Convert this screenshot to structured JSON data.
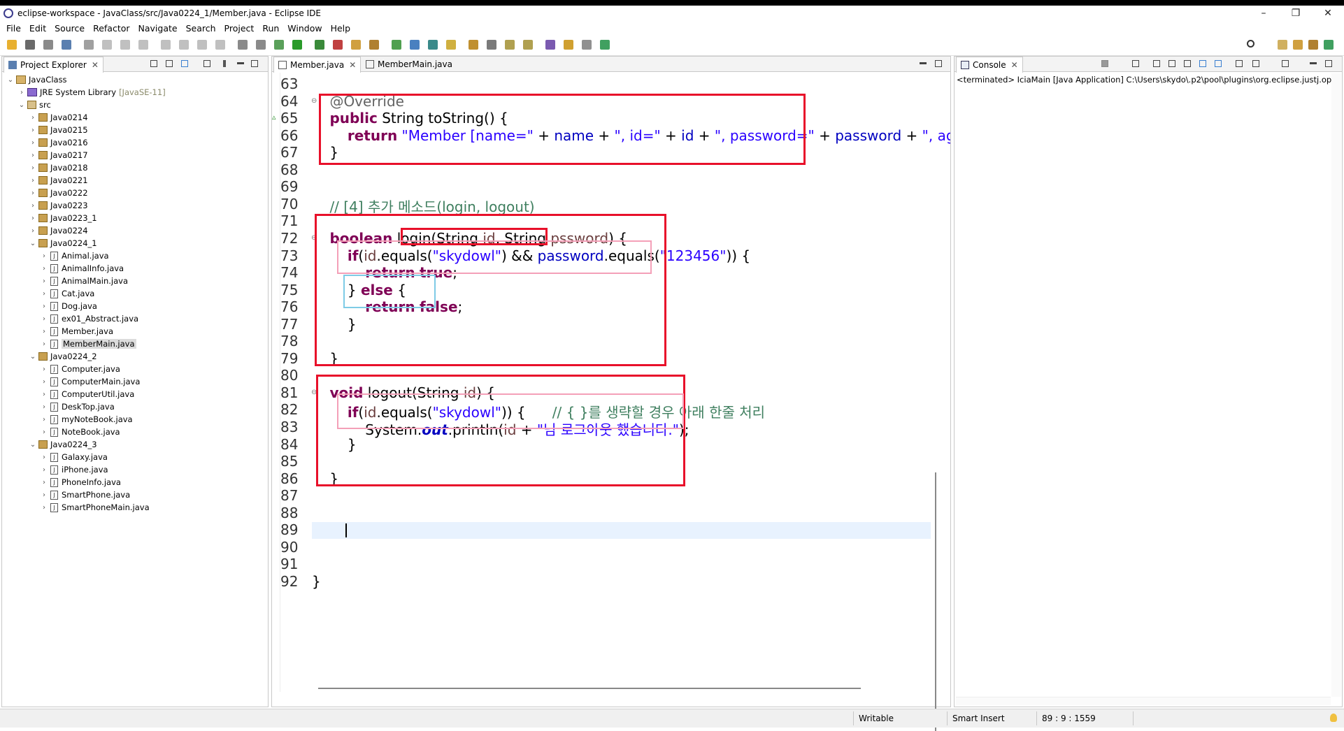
{
  "window": {
    "title": "eclipse-workspace - JavaClass/src/Java0224_1/Member.java - Eclipse IDE",
    "minimize": "–",
    "maximize": "❐",
    "close": "✕"
  },
  "menu": [
    "File",
    "Edit",
    "Source",
    "Refactor",
    "Navigate",
    "Search",
    "Project",
    "Run",
    "Window",
    "Help"
  ],
  "project_explorer": {
    "tab_label": "Project Explorer",
    "items": [
      {
        "label": "JavaClass",
        "type": "project",
        "level": 0,
        "expanded": true
      },
      {
        "label": "JRE System Library",
        "suffix": "[JavaSE-11]",
        "type": "library",
        "level": 1,
        "expanded": false
      },
      {
        "label": "src",
        "type": "folder",
        "level": 1,
        "expanded": true
      },
      {
        "label": "Java0214",
        "type": "package",
        "level": 2,
        "expanded": false
      },
      {
        "label": "Java0215",
        "type": "package",
        "level": 2,
        "expanded": false
      },
      {
        "label": "Java0216",
        "type": "package",
        "level": 2,
        "expanded": false
      },
      {
        "label": "Java0217",
        "type": "package",
        "level": 2,
        "expanded": false
      },
      {
        "label": "Java0218",
        "type": "package",
        "level": 2,
        "expanded": false
      },
      {
        "label": "Java0221",
        "type": "package",
        "level": 2,
        "expanded": false
      },
      {
        "label": "Java0222",
        "type": "package",
        "level": 2,
        "expanded": false
      },
      {
        "label": "Java0223",
        "type": "package",
        "level": 2,
        "expanded": false
      },
      {
        "label": "Java0223_1",
        "type": "package",
        "level": 2,
        "expanded": false
      },
      {
        "label": "Java0224",
        "type": "package",
        "level": 2,
        "expanded": false
      },
      {
        "label": "Java0224_1",
        "type": "package",
        "level": 2,
        "expanded": true
      },
      {
        "label": "Animal.java",
        "type": "file",
        "level": 3,
        "expanded": false
      },
      {
        "label": "AnimalInfo.java",
        "type": "file",
        "level": 3,
        "expanded": false
      },
      {
        "label": "AnimalMain.java",
        "type": "file",
        "level": 3,
        "expanded": false
      },
      {
        "label": "Cat.java",
        "type": "file",
        "level": 3,
        "expanded": false
      },
      {
        "label": "Dog.java",
        "type": "file",
        "level": 3,
        "expanded": false
      },
      {
        "label": "ex01_Abstract.java",
        "type": "file",
        "level": 3,
        "expanded": false
      },
      {
        "label": "Member.java",
        "type": "file",
        "level": 3,
        "expanded": false
      },
      {
        "label": "MemberMain.java",
        "type": "file",
        "level": 3,
        "expanded": false,
        "selected": true
      },
      {
        "label": "Java0224_2",
        "type": "package",
        "level": 2,
        "expanded": true
      },
      {
        "label": "Computer.java",
        "type": "file",
        "level": 3,
        "expanded": false
      },
      {
        "label": "ComputerMain.java",
        "type": "file",
        "level": 3,
        "expanded": false
      },
      {
        "label": "ComputerUtil.java",
        "type": "file",
        "level": 3,
        "expanded": false
      },
      {
        "label": "DeskTop.java",
        "type": "file",
        "level": 3,
        "expanded": false
      },
      {
        "label": "myNoteBook.java",
        "type": "file",
        "level": 3,
        "expanded": false
      },
      {
        "label": "NoteBook.java",
        "type": "file",
        "level": 3,
        "expanded": false
      },
      {
        "label": "Java0224_3",
        "type": "package",
        "level": 2,
        "expanded": true
      },
      {
        "label": "Galaxy.java",
        "type": "file",
        "level": 3,
        "expanded": false
      },
      {
        "label": "iPhone.java",
        "type": "file",
        "level": 3,
        "expanded": false
      },
      {
        "label": "PhoneInfo.java",
        "type": "file",
        "level": 3,
        "expanded": false
      },
      {
        "label": "SmartPhone.java",
        "type": "file",
        "level": 3,
        "expanded": false
      },
      {
        "label": "SmartPhoneMain.java",
        "type": "file",
        "level": 3,
        "expanded": false
      }
    ]
  },
  "editor": {
    "tabs": [
      {
        "label": "Member.java",
        "active": true
      },
      {
        "label": "MemberMain.java",
        "active": false
      }
    ],
    "lines": [
      {
        "n": "63",
        "tokens": []
      },
      {
        "n": "64",
        "fold": "⊖",
        "tokens": [
          {
            "t": "    "
          },
          {
            "t": "@Override",
            "c": "ann"
          }
        ]
      },
      {
        "n": "65",
        "marker": "▵",
        "tokens": [
          {
            "t": "    "
          },
          {
            "t": "public",
            "c": "kw"
          },
          {
            "t": " String toString() {"
          }
        ]
      },
      {
        "n": "66",
        "tokens": [
          {
            "t": "        "
          },
          {
            "t": "return",
            "c": "kw"
          },
          {
            "t": " "
          },
          {
            "t": "\"Member [name=\"",
            "c": "str"
          },
          {
            "t": " + "
          },
          {
            "t": "name",
            "c": "fld"
          },
          {
            "t": " + "
          },
          {
            "t": "\", id=\"",
            "c": "str"
          },
          {
            "t": " + "
          },
          {
            "t": "id",
            "c": "fld"
          },
          {
            "t": " + "
          },
          {
            "t": "\", password=\"",
            "c": "str"
          },
          {
            "t": " + "
          },
          {
            "t": "password",
            "c": "fld"
          },
          {
            "t": " + "
          },
          {
            "t": "\", age=\"",
            "c": "str"
          },
          {
            "t": " +"
          }
        ]
      },
      {
        "n": "67",
        "tokens": [
          {
            "t": "    }"
          }
        ]
      },
      {
        "n": "68",
        "tokens": []
      },
      {
        "n": "69",
        "tokens": []
      },
      {
        "n": "70",
        "tokens": [
          {
            "t": "    "
          },
          {
            "t": "// [4] 추가 메소드(login, logout)",
            "c": "cm"
          }
        ]
      },
      {
        "n": "71",
        "tokens": []
      },
      {
        "n": "72",
        "fold": "⊖",
        "tokens": [
          {
            "t": "    "
          },
          {
            "t": "boolean",
            "c": "kw"
          },
          {
            "t": " login("
          },
          {
            "t": "String "
          },
          {
            "t": "id",
            "c": "par"
          },
          {
            "t": ", String "
          },
          {
            "t": "pssword",
            "c": "par"
          },
          {
            "t": ") {"
          }
        ]
      },
      {
        "n": "73",
        "tokens": [
          {
            "t": "        "
          },
          {
            "t": "if",
            "c": "kw"
          },
          {
            "t": "("
          },
          {
            "t": "id",
            "c": "par"
          },
          {
            "t": ".equals("
          },
          {
            "t": "\"skydowl\"",
            "c": "str"
          },
          {
            "t": ") && "
          },
          {
            "t": "password",
            "c": "fld"
          },
          {
            "t": ".equals("
          },
          {
            "t": "\"123456\"",
            "c": "str"
          },
          {
            "t": ")) {"
          }
        ]
      },
      {
        "n": "74",
        "tokens": [
          {
            "t": "            "
          },
          {
            "t": "return",
            "c": "kw"
          },
          {
            "t": " "
          },
          {
            "t": "true",
            "c": "kw"
          },
          {
            "t": ";"
          }
        ]
      },
      {
        "n": "75",
        "tokens": [
          {
            "t": "        } "
          },
          {
            "t": "else",
            "c": "kw"
          },
          {
            "t": " {"
          }
        ]
      },
      {
        "n": "76",
        "tokens": [
          {
            "t": "            "
          },
          {
            "t": "return",
            "c": "kw"
          },
          {
            "t": " "
          },
          {
            "t": "false",
            "c": "kw"
          },
          {
            "t": ";"
          }
        ]
      },
      {
        "n": "77",
        "tokens": [
          {
            "t": "        }"
          }
        ]
      },
      {
        "n": "78",
        "tokens": []
      },
      {
        "n": "79",
        "tokens": [
          {
            "t": "    }"
          }
        ]
      },
      {
        "n": "80",
        "tokens": []
      },
      {
        "n": "81",
        "fold": "⊖",
        "tokens": [
          {
            "t": "    "
          },
          {
            "t": "void",
            "c": "kw"
          },
          {
            "t": " logout(String "
          },
          {
            "t": "id",
            "c": "par"
          },
          {
            "t": ") {"
          }
        ]
      },
      {
        "n": "82",
        "tokens": [
          {
            "t": "        "
          },
          {
            "t": "if",
            "c": "kw"
          },
          {
            "t": "("
          },
          {
            "t": "id",
            "c": "par"
          },
          {
            "t": ".equals("
          },
          {
            "t": "\"skydowl\"",
            "c": "str"
          },
          {
            "t": ")) {      "
          },
          {
            "t": "// { }를 생략할 경우 아래 한줄 처리",
            "c": "cm"
          }
        ]
      },
      {
        "n": "83",
        "tokens": [
          {
            "t": "            System."
          },
          {
            "t": "out",
            "c": "sfld"
          },
          {
            "t": ".println("
          },
          {
            "t": "id",
            "c": "par"
          },
          {
            "t": " + "
          },
          {
            "t": "\"님 로그아웃 했습니다.\"",
            "c": "str"
          },
          {
            "t": ");"
          }
        ]
      },
      {
        "n": "84",
        "tokens": [
          {
            "t": "        }"
          }
        ]
      },
      {
        "n": "85",
        "tokens": []
      },
      {
        "n": "86",
        "tokens": [
          {
            "t": "    }"
          }
        ]
      },
      {
        "n": "87",
        "tokens": []
      },
      {
        "n": "88",
        "tokens": []
      },
      {
        "n": "89",
        "current": true,
        "tokens": [
          {
            "t": "    "
          }
        ]
      },
      {
        "n": "90",
        "tokens": []
      },
      {
        "n": "91",
        "tokens": []
      },
      {
        "n": "92",
        "tokens": [
          {
            "t": "}"
          }
        ]
      }
    ]
  },
  "console": {
    "tab_label": "Console",
    "text": "<terminated> IciaMain [Java Application] C:\\Users\\skydo\\.p2\\pool\\plugins\\org.eclipse.justj.openjc"
  },
  "status": {
    "writable": "Writable",
    "insert_mode": "Smart Insert",
    "position": "89 : 9 : 1559"
  },
  "colors": {
    "highlight_red": "#e8102a",
    "highlight_pink": "#f4a0b8",
    "highlight_cyan": "#7ecbe6",
    "keyword": "#7f0055",
    "string": "#2a00ff",
    "comment": "#3f7f5f"
  }
}
